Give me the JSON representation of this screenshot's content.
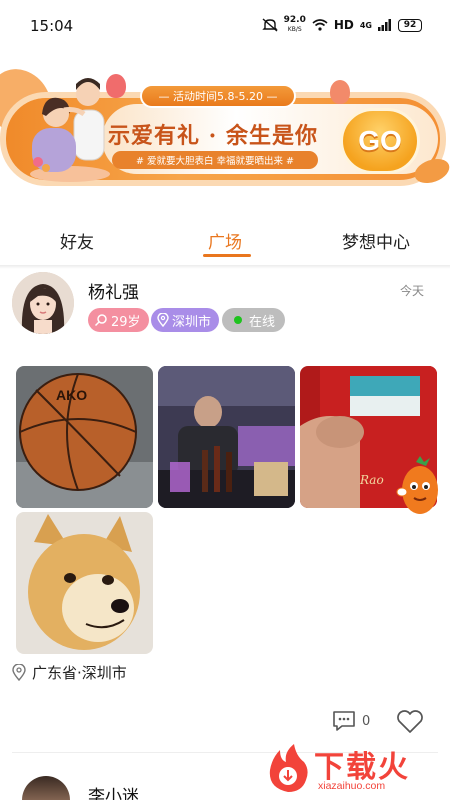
{
  "status_bar": {
    "time": "15:04",
    "net_speed": "92.0",
    "net_unit": "KB/S",
    "hd": "HD",
    "signal": "4G",
    "battery": "92"
  },
  "banner": {
    "period": "— 活动时间5.8-5.20 —",
    "title": "示爱有礼 · 余生是你",
    "subtitle": "# 爱就要大胆表白  幸福就要晒出来 #",
    "go_label": "GO"
  },
  "tabs": [
    {
      "label": "好友",
      "active": false
    },
    {
      "label": "广场",
      "active": true
    },
    {
      "label": "梦想中心",
      "active": false
    }
  ],
  "post": {
    "username": "杨礼强",
    "time": "今天",
    "age": "29岁",
    "city": "深圳市",
    "status": "在线",
    "location": "广东省·深圳市",
    "comment_count": "0"
  },
  "next_post": {
    "username": "李小迷"
  },
  "watermark": {
    "brand": "下载火",
    "url": "xiazaihuo.com"
  },
  "colors": {
    "accent": "#e9761e",
    "age_badge": "#f48fa0",
    "city_badge": "#a98de8",
    "online_badge": "#bdbdbd",
    "online_dot": "#1ec31e"
  }
}
